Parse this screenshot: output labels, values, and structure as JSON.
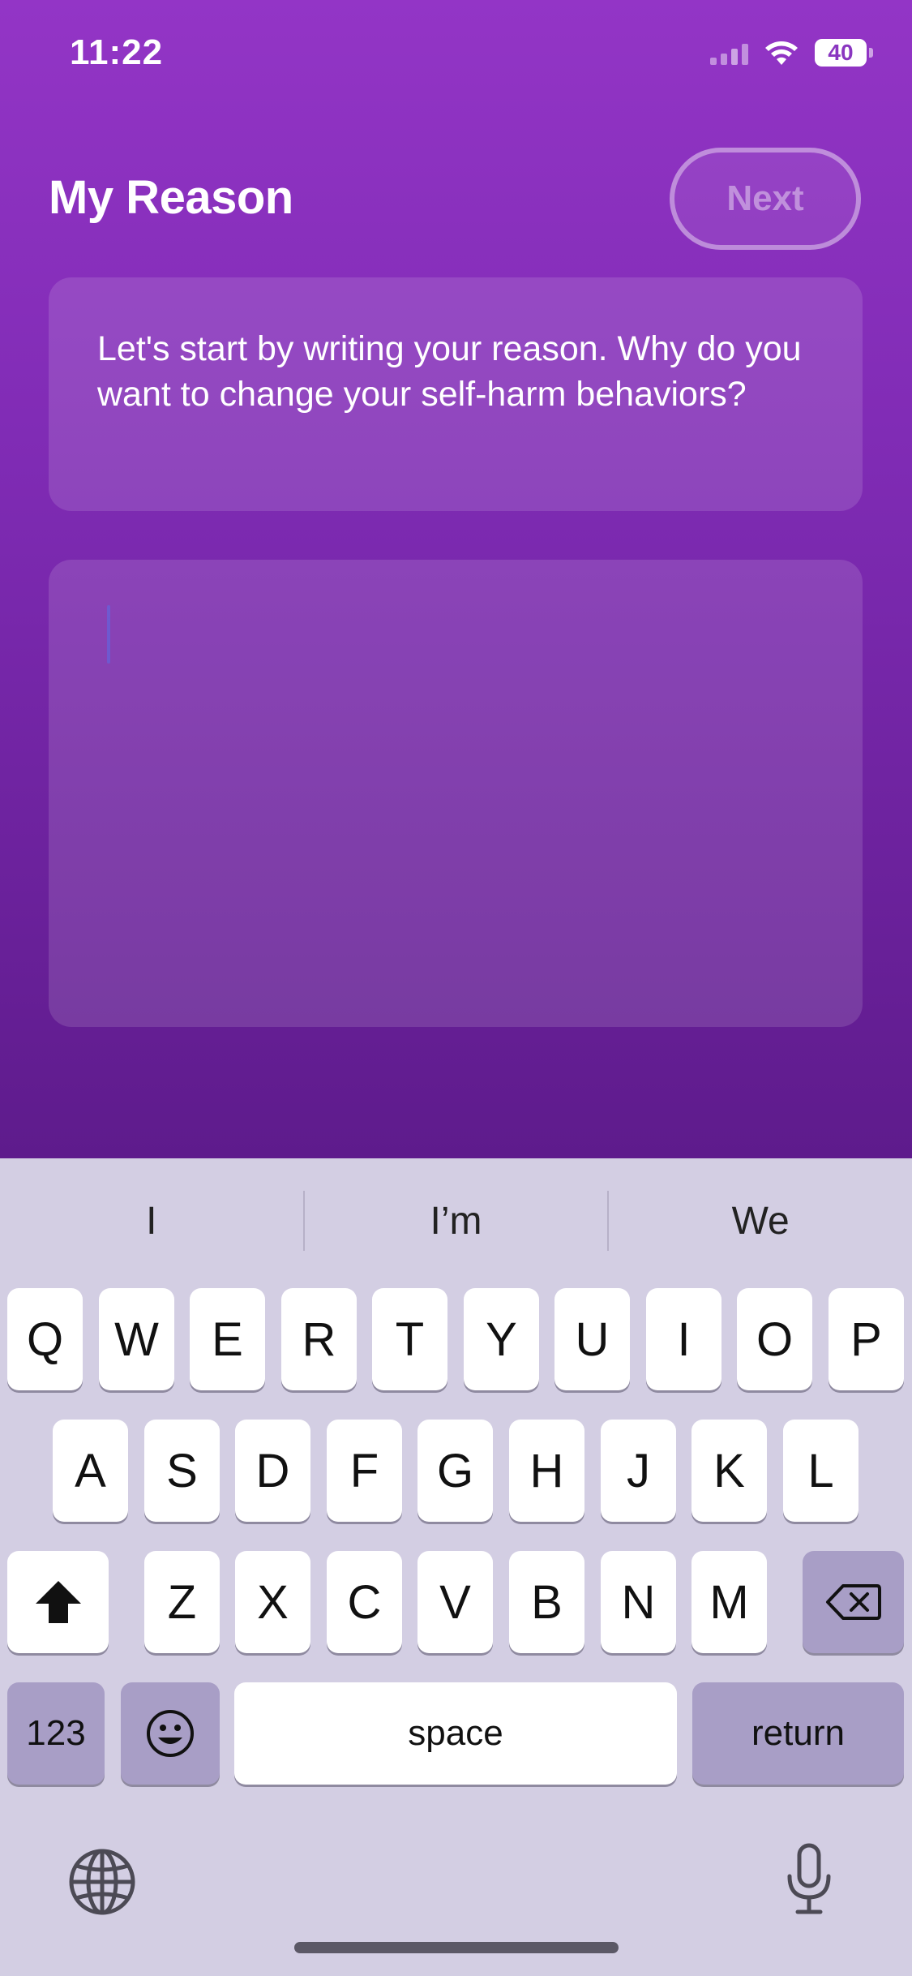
{
  "status_bar": {
    "time": "11:22",
    "battery": "40"
  },
  "header": {
    "title": "My Reason",
    "next_label": "Next"
  },
  "prompt": {
    "text": "Let's start by writing your reason. Why do you want to change your self-harm behaviors?"
  },
  "answer": {
    "value": ""
  },
  "keyboard": {
    "suggestions": [
      "I",
      "I’m",
      "We"
    ],
    "row1": [
      "Q",
      "W",
      "E",
      "R",
      "T",
      "Y",
      "U",
      "I",
      "O",
      "P"
    ],
    "row2": [
      "A",
      "S",
      "D",
      "F",
      "G",
      "H",
      "J",
      "K",
      "L"
    ],
    "row3": [
      "Z",
      "X",
      "C",
      "V",
      "B",
      "N",
      "M"
    ],
    "numbers_label": "123",
    "space_label": "space",
    "return_label": "return"
  },
  "colors": {
    "background_top": "#9335c6",
    "background_bottom": "#5e1b8c",
    "keyboard_bg": "#d3cee3"
  }
}
